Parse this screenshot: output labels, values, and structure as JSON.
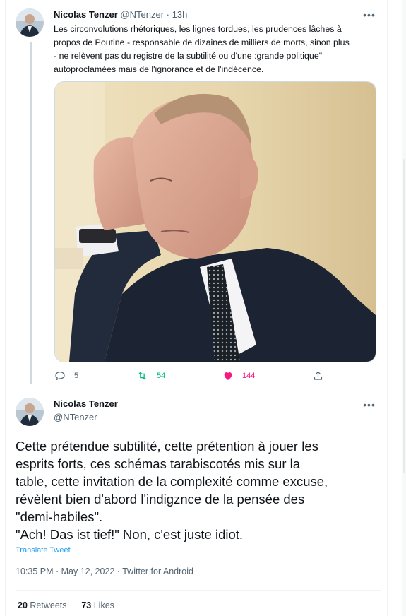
{
  "tweet1": {
    "author_name": "Nicolas Tenzer",
    "handle": "@NTenzer",
    "separator": "·",
    "time": "13h",
    "more_label": "•••",
    "text_lines": [
      "Les circonvolutions rhétoriques, les lignes tordues, les prudences lâches à",
      "propos de Poutine - responsable de dizaines de milliers de morts, sinon plus",
      "- ne relèvent pas du registre de la subtilité ou d'une :grande politique\"",
      "autoproclamées mais de l'ignorance et de l'indécence."
    ],
    "actions": {
      "replies": "5",
      "retweets": "54",
      "likes": "144"
    },
    "colors": {
      "retweet": "#00ba7c",
      "like": "#f91880"
    }
  },
  "tweet2": {
    "author_name": "Nicolas Tenzer",
    "handle": "@NTenzer",
    "more_label": "•••",
    "text_lines": [
      "Cette prétendue subtilité, cette prétention à jouer les",
      "esprits forts, ces schémas tarabiscotés mis sur la",
      "table, cette invitation de la complexité comme excuse,",
      "révèlent bien d'abord l'indigznce de la pensée des",
      "\"demi-habiles\".",
      "\"Ach! Das ist tief!\" Non, c'est juste idiot."
    ],
    "translate_label": "Translate Tweet",
    "meta": "10:35 PM · May 12, 2022 · Twitter for Android",
    "retweets_count": "20",
    "retweets_label": "Retweets",
    "likes_count": "73",
    "likes_label": "Likes"
  }
}
